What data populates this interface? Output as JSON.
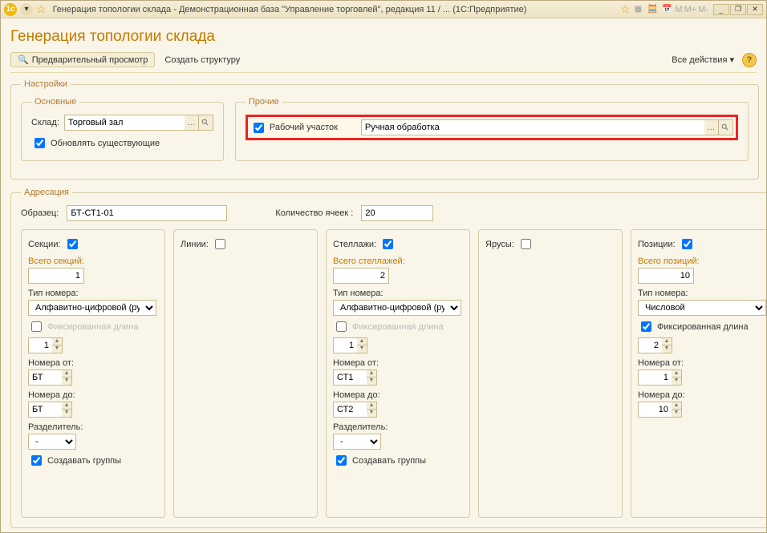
{
  "window": {
    "title": "Генерация топологии склада - Демонстрационная база \"Управление торговлей\", редакция 11 / ...   (1С:Предприятие)"
  },
  "page": {
    "title": "Генерация топологии склада"
  },
  "toolbar": {
    "preview": "Предварительный просмотр",
    "create": "Создать структуру",
    "all_actions": "Все действия"
  },
  "settings_legend": "Настройки",
  "main": {
    "legend": "Основные",
    "sklad_label": "Склад:",
    "sklad_value": "Торговый зал",
    "update_existing": "Обновлять существующие"
  },
  "other": {
    "legend": "Прочие",
    "work_area_label": "Рабочий участок",
    "work_area_value": "Ручная обработка"
  },
  "addr": {
    "legend": "Адресация",
    "sample_label": "Образец:",
    "sample_value": "БТ-СТ1-01",
    "cells_label": "Количество ячеек :",
    "cells_value": "20"
  },
  "cols": {
    "sections": {
      "title": "Секции:",
      "total": "Всего секций:",
      "total_val": "1",
      "type_label": "Тип номера:",
      "type_val": "Алфавитно-цифровой (рус.)",
      "fixed": "Фиксированная длина",
      "fixed_val": "1",
      "from_label": "Номера от:",
      "from_val": "БТ",
      "to_label": "Номера до:",
      "to_val": "БТ",
      "sep_label": "Разделитель:",
      "sep_val": "-",
      "groups": "Создавать группы"
    },
    "lines": {
      "title": "Линии:"
    },
    "racks": {
      "title": "Стеллажи:",
      "total": "Всего стеллажей:",
      "total_val": "2",
      "type_label": "Тип номера:",
      "type_val": "Алфавитно-цифровой (рус.)",
      "fixed": "Фиксированная длина",
      "fixed_val": "1",
      "from_label": "Номера от:",
      "from_val": "СТ1",
      "to_label": "Номера до:",
      "to_val": "СТ2",
      "sep_label": "Разделитель:",
      "sep_val": "-",
      "groups": "Создавать группы"
    },
    "tiers": {
      "title": "Ярусы:"
    },
    "positions": {
      "title": "Позиции:",
      "total": "Всего позиций:",
      "total_val": "10",
      "type_label": "Тип номера:",
      "type_val": "Числовой",
      "fixed": "Фиксированная длина",
      "fixed_val": "2",
      "from_label": "Номера от:",
      "from_val": "1",
      "to_label": "Номера до:",
      "to_val": "10"
    }
  }
}
